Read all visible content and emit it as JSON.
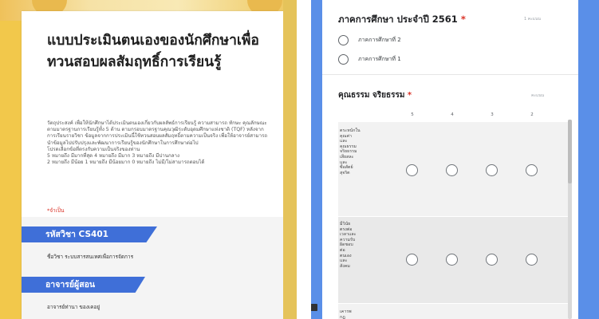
{
  "left_screen": {
    "form_title": "แบบประเมินตนเองของนักศึกษาเพื่อทวนสอบผลสัมฤทธิ์การเรียนรู้",
    "description": "วัตถุประสงค์ เพื่อให้นักศึกษาได้ประเมินตนเองเกี่ยวกับผลลัพธ์การเรียนรู้ ความสามารถ ทักษะ คุณลักษณะ ตามมาตรฐานการเรียนรู้ทั้ง 5 ด้าน ตามกรอบมาตรฐานคุณวุฒิระดับอุดมศึกษาแห่งชาติ (TQF) หลังจากการเรียนรายวิชา ข้อมูลจากการประเมินนี้ใช้ทวนสอบผลสัมฤทธิ์ตามความเป็นจริง เพื่อให้อาจารย์สามารถนำข้อมูลไปปรับปรุงและพัฒนาการเรียนรู้ของนักศึกษาในการศึกษาต่อไป\nโปรดเลือกข้อที่ตรงกับความเป็นจริงของท่าน\n5 หมายถึง มีมากที่สุด   4 หมายถึง มีมาก   3 หมายถึง มีปานกลาง\n2 หมายถึง มีน้อย   1 หมายถึง มีน้อยมาก   0 หมายถึง ไม่มี/ไม่สามารถตอบได้",
    "required_note": "*จำเป็น",
    "sections": [
      {
        "header": "รหัสวิชา CS401",
        "text": "ชื่อวิชา ระบบสารสนเทศเพื่อการจัดการ"
      },
      {
        "header": "อาจารย์ผู้สอน",
        "text": "อาจารย์ท่านา ของเคอยู่"
      }
    ]
  },
  "right_screen": {
    "q1": {
      "title": "ภาคการศึกษา ประจำปี 2561",
      "required_mark": "*",
      "hint": "1 คะแนน",
      "options": [
        "ภาคการศึกษาที่ 2",
        "ภาคการศึกษาที่ 1"
      ]
    },
    "q2": {
      "title": "คุณธรรม จริยธรรม",
      "required_mark": "*",
      "hint": "คะแนน",
      "columns": [
        "5",
        "4",
        "3",
        "2"
      ],
      "rows": [
        "ตระหนักใน\nคุณค่า\nและ\nคุณธรรม\nจริยธรรม\nเสียสละ\nและ\nซื่อสัตย์\nสุจริต",
        "มีวินัย\nตรงต่อ\nเวลาและ\nความรับ\nผิดชอบ\nต่อ\nตนเอง\nและ\nสังคม",
        "เคารพ\nกฎ"
      ]
    }
  }
}
